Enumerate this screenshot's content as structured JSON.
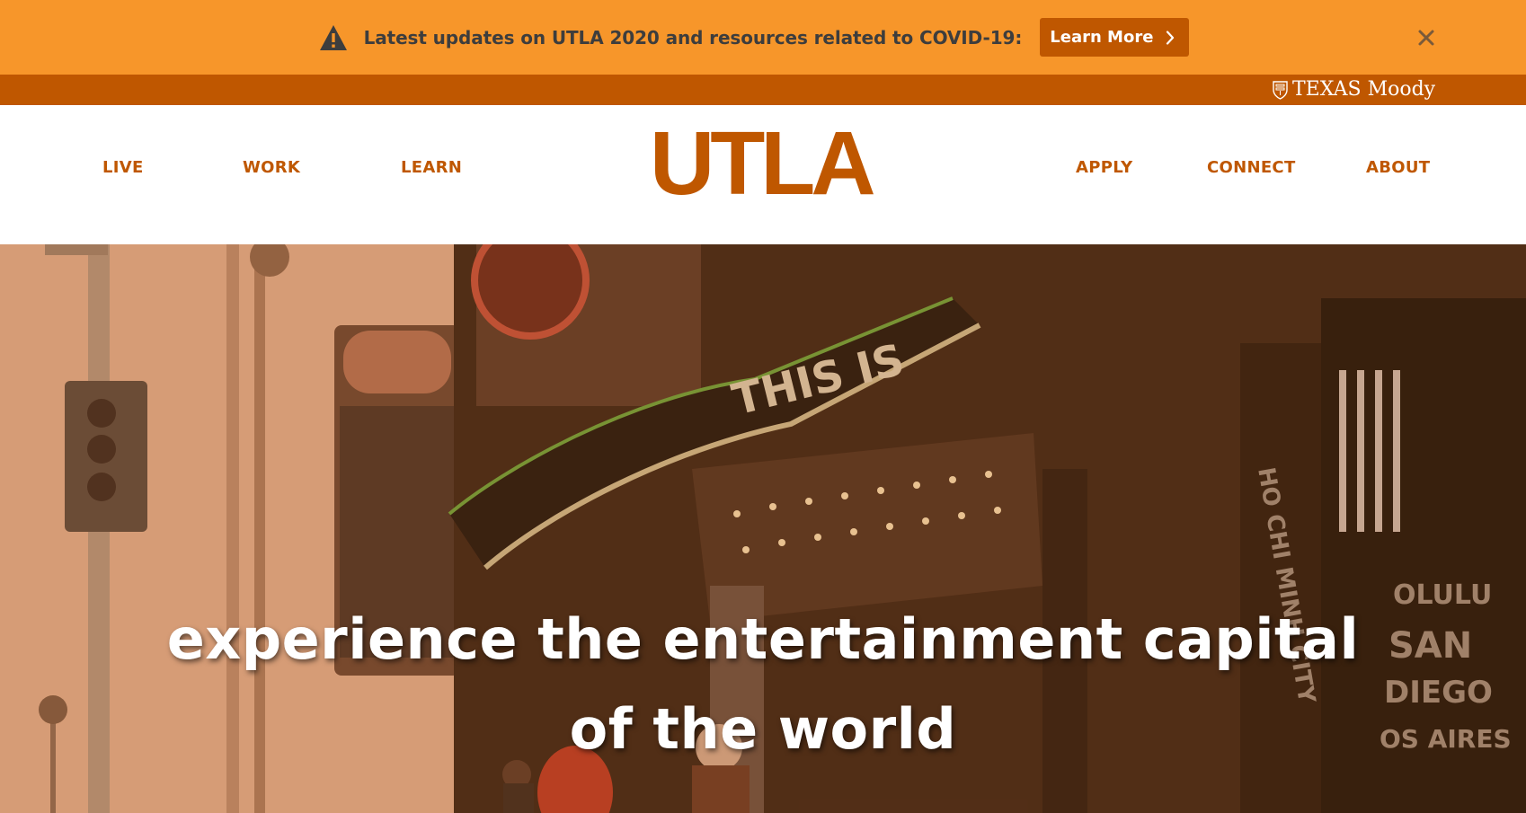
{
  "alert": {
    "icon": "warning-icon",
    "message": "Latest updates on UTLA 2020 and resources related to COVID-19:",
    "button_label": "Learn More",
    "close_icon": "close-icon"
  },
  "moody_bar": {
    "brand_text": "TEXAS Moody",
    "icon": "shield-icon"
  },
  "nav": {
    "logo": "UTLA",
    "left_items": [
      "LIVE",
      "WORK",
      "LEARN"
    ],
    "right_items": [
      "APPLY",
      "CONNECT",
      "ABOUT"
    ]
  },
  "hero": {
    "headline_line1": "experience the entertainment capital",
    "headline_line2": "of the world"
  },
  "colors": {
    "alert_bg": "#f7962a",
    "burnt_orange": "#bf5700",
    "alert_text": "#3d3d3d",
    "white": "#ffffff"
  }
}
